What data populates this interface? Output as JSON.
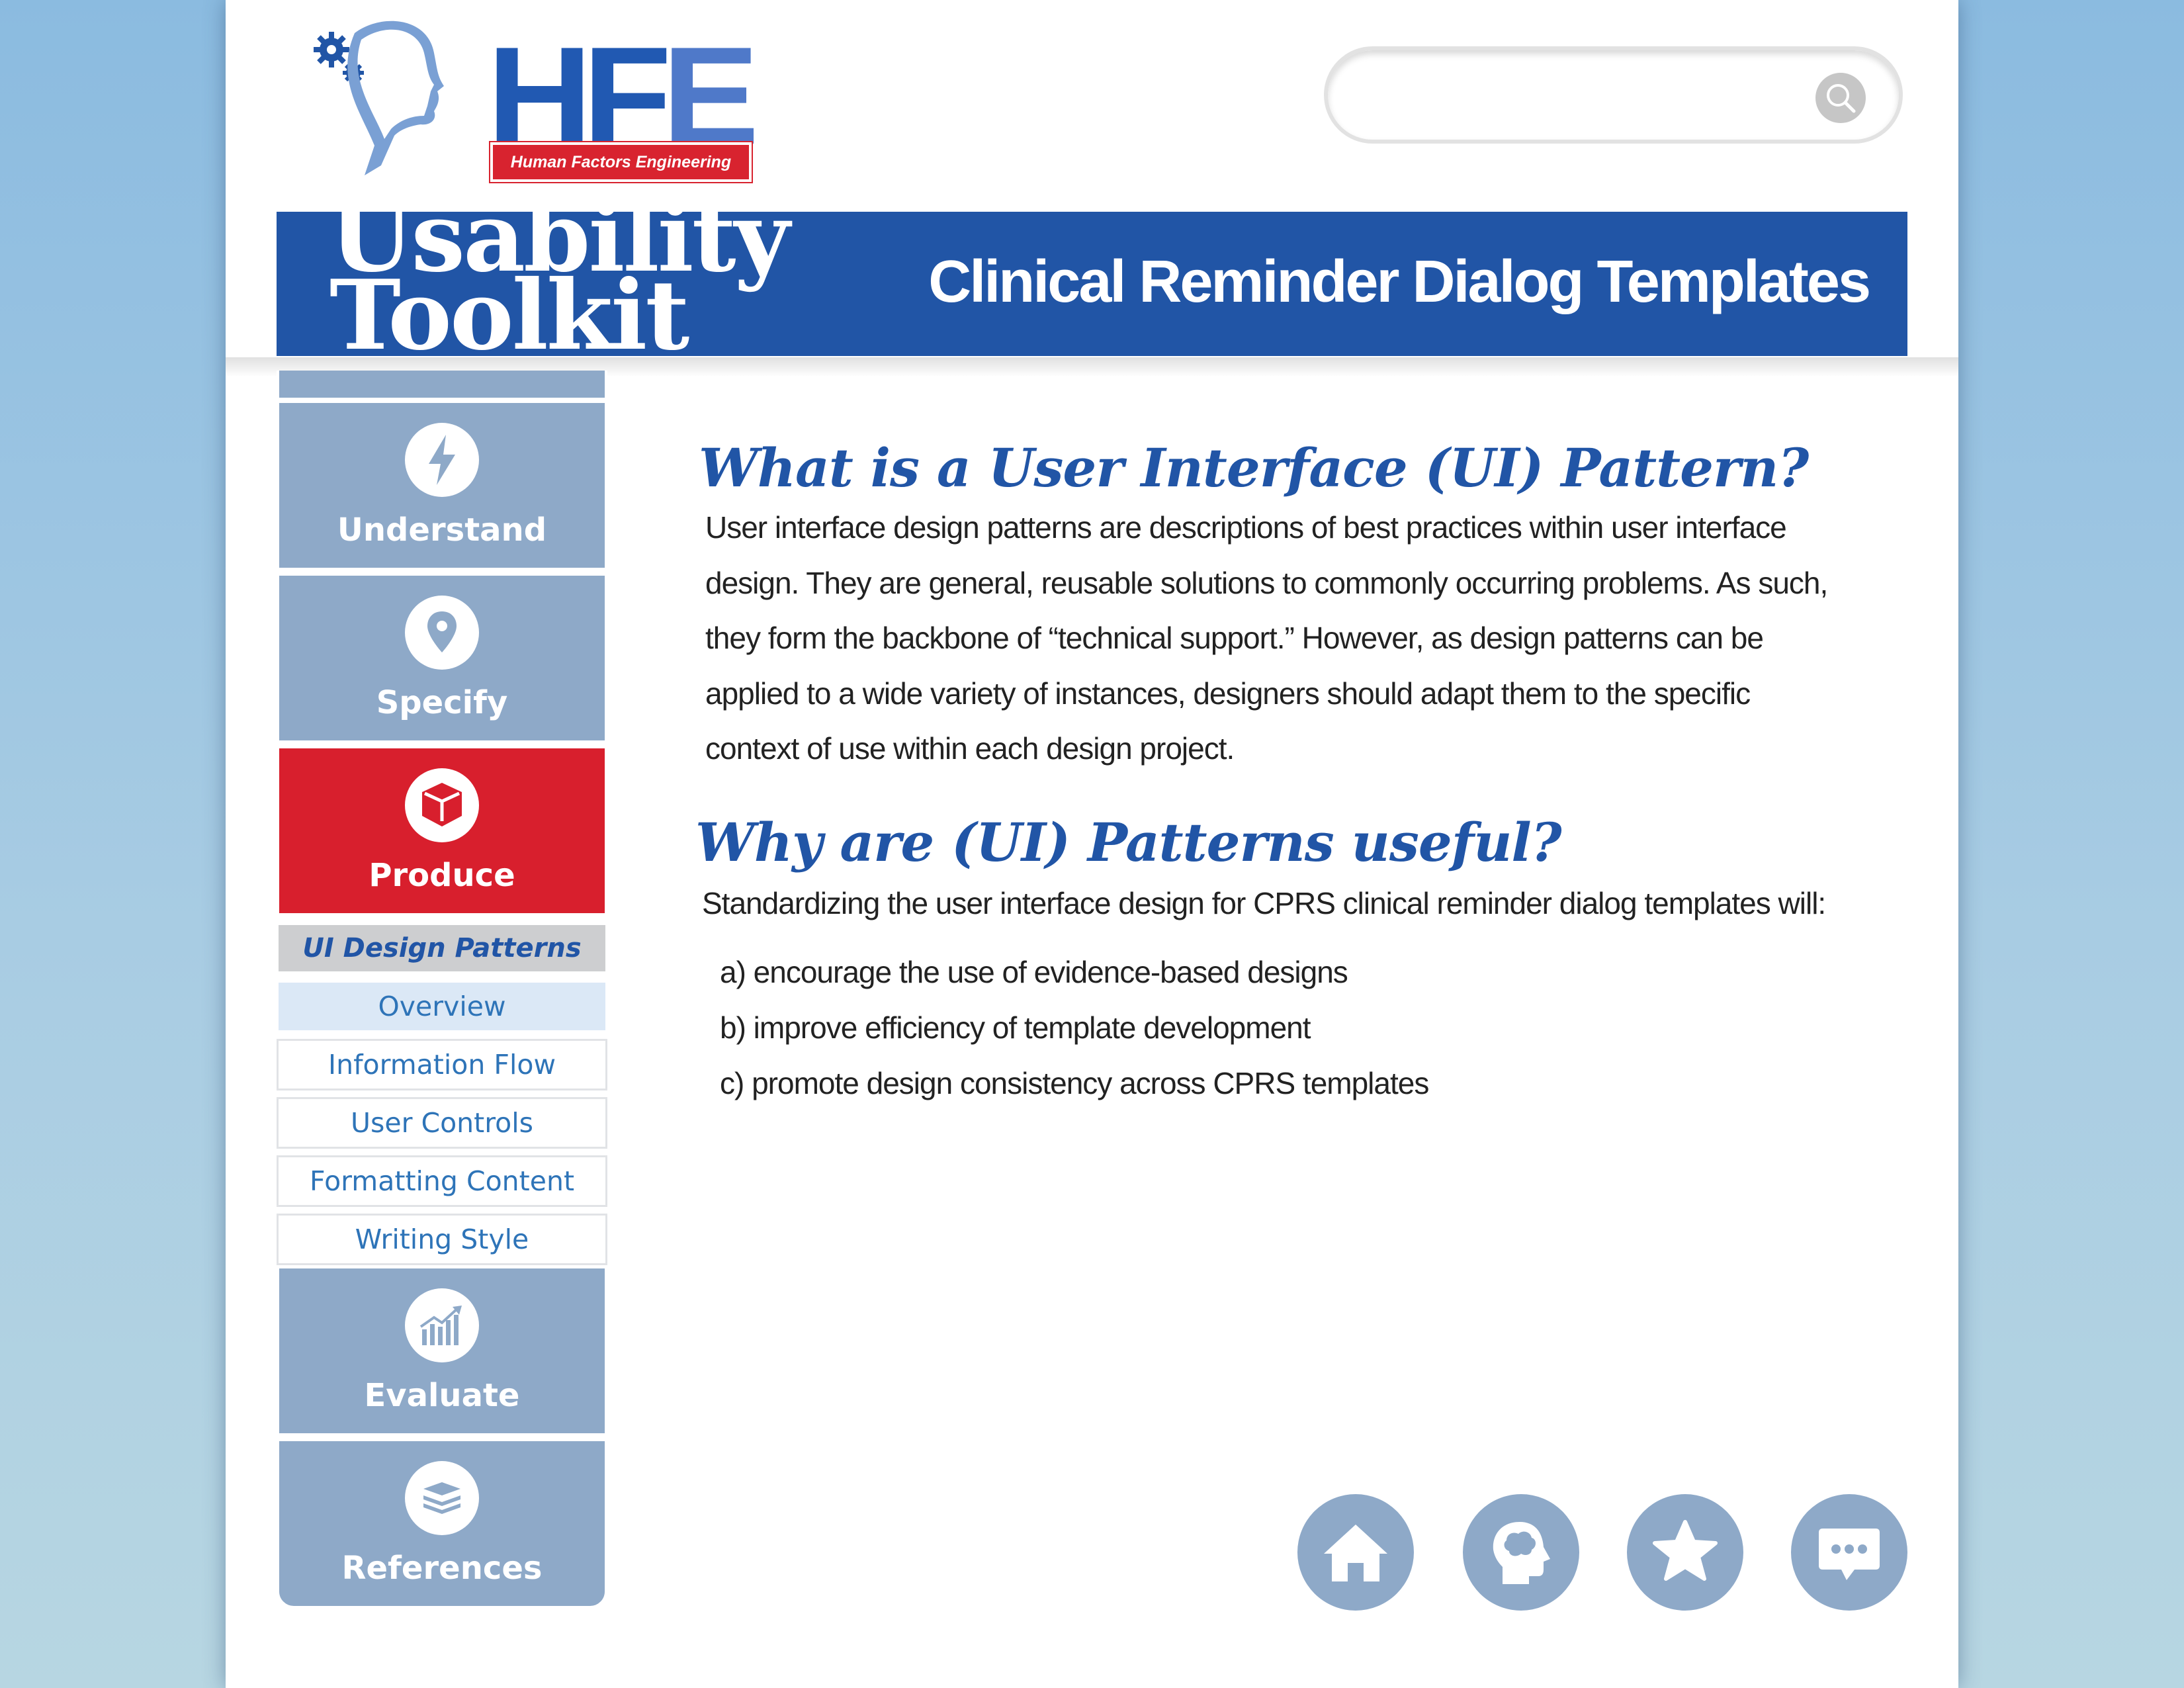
{
  "logo": {
    "text": "HFE",
    "subtitle": "Human Factors Engineering"
  },
  "search": {
    "placeholder": "",
    "value": ""
  },
  "banner": {
    "title_line1": "Usability",
    "title_line2": "Toolkit",
    "subtitle": "Clinical Reminder Dialog Templates"
  },
  "sidebar": {
    "tabs": [
      {
        "label": "Understand",
        "icon": "lightning-icon"
      },
      {
        "label": "Specify",
        "icon": "map-pin-icon"
      },
      {
        "label": "Produce",
        "icon": "box-icon",
        "active": true
      },
      {
        "label": "Evaluate",
        "icon": "chart-growth-icon"
      },
      {
        "label": "References",
        "icon": "books-icon"
      }
    ],
    "subheader": "UI Design Patterns",
    "subitems": [
      {
        "label": "Overview",
        "current": true
      },
      {
        "label": "Information Flow"
      },
      {
        "label": "User Controls"
      },
      {
        "label": "Formatting Content"
      },
      {
        "label": "Writing Style"
      }
    ]
  },
  "content": {
    "heading1": "What is a User Interface (UI) Pattern?",
    "para1_lines": [
      "User interface design patterns are descriptions of best practices within user interface",
      "design. They are general, reusable solutions to commonly occurring problems. As such,",
      "they form the backbone of “technical support.”  However, as design patterns can be",
      "applied to a wide variety of instances, designers should adapt them to the specific",
      "context of use within each design project."
    ],
    "heading2": "Why are (UI) Patterns useful?",
    "para2": "Standardizing the user interface design for CPRS clinical reminder dialog templates will:",
    "list": [
      "a)  encourage the use of evidence-based designs",
      "b)  improve efficiency of template development",
      "c)  promote design consistency across CPRS templates"
    ]
  },
  "bottom_nav": [
    {
      "name": "home-button",
      "icon": "home-icon"
    },
    {
      "name": "brain-button",
      "icon": "brain-head-icon"
    },
    {
      "name": "favorites-button",
      "icon": "star-icon"
    },
    {
      "name": "feedback-button",
      "icon": "chat-bubble-icon"
    }
  ],
  "colors": {
    "brand_blue": "#2155a6",
    "active_red": "#d81f2d",
    "tab_gray_blue": "#8ea9c8",
    "link_blue": "#2e74b8"
  }
}
